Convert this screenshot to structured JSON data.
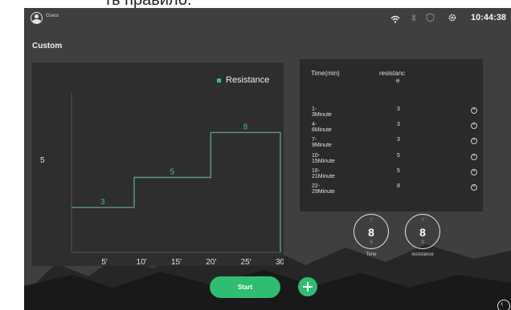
{
  "caption_fragment": "ть правило.",
  "status": {
    "user_name": "Guest",
    "time": "10:44:38",
    "icons": [
      "wifi-icon",
      "bluetooth-icon",
      "shield-icon",
      "settings-gear-icon"
    ]
  },
  "page": {
    "title": "Custom"
  },
  "chart_data": {
    "type": "step",
    "legend": "Resistance",
    "y_tick_labels": [
      "5"
    ],
    "x_ticks": [
      5,
      10,
      15,
      20,
      25,
      30
    ],
    "x_tick_labels": [
      "5'",
      "10'",
      "15'",
      "20'",
      "25'",
      "30'"
    ],
    "xlim": [
      0,
      30
    ],
    "ylim": [
      0,
      10
    ],
    "steps": [
      {
        "from": 0,
        "to": 9,
        "value": 3,
        "label": "3"
      },
      {
        "from": 9,
        "to": 20,
        "value": 5,
        "label": "5"
      },
      {
        "from": 20,
        "to": 30,
        "value": 8,
        "label": "8"
      }
    ],
    "colors": {
      "line": "#5f9b7a",
      "label": "#3ec27e",
      "dot": "#36c27a"
    }
  },
  "table": {
    "col_time": "Time(min)",
    "col_resistance_1": "resistanc",
    "col_resistance_2": "e",
    "rows": [
      {
        "time": "1-3Minute",
        "resistance": "3"
      },
      {
        "time": "4-6Minute",
        "resistance": "3"
      },
      {
        "time": "7-9Minute",
        "resistance": "3"
      },
      {
        "time": "10-15Minute",
        "resistance": "5"
      },
      {
        "time": "16-21Minute",
        "resistance": "5"
      },
      {
        "time": "22-29Minute",
        "resistance": "8"
      }
    ]
  },
  "dials": {
    "time": {
      "above": "7",
      "value": "8",
      "below": "9",
      "label": "Time"
    },
    "resistance": {
      "above": "7",
      "value": "8",
      "below": "9",
      "label": "resistance"
    }
  },
  "actions": {
    "start": "Start"
  },
  "colors": {
    "accent": "#2fbd71",
    "panel": "#2e2e2e",
    "screen": "#3f3f3f"
  }
}
